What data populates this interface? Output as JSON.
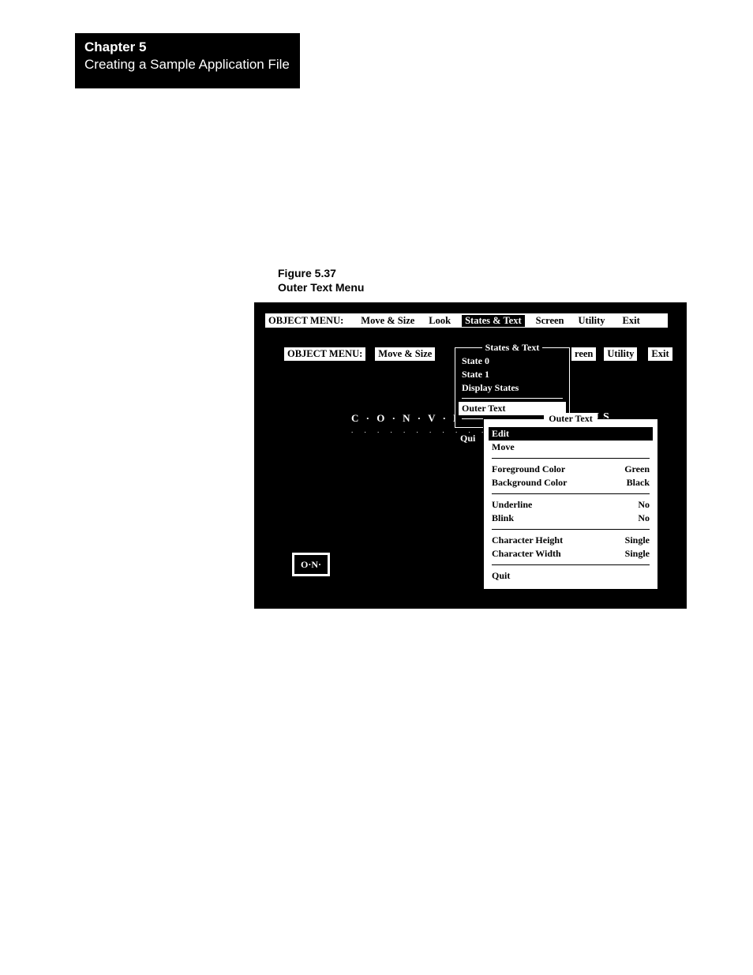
{
  "chapter": {
    "number": "Chapter 5",
    "title": "Creating a Sample Application File"
  },
  "figure": {
    "number": "Figure 5.37",
    "title": "Outer Text Menu"
  },
  "menubar_top": {
    "title": "OBJECT MENU:",
    "items": [
      "Move & Size",
      "Look",
      "States & Text",
      "Screen",
      "Utility",
      "Exit"
    ],
    "selected": "States & Text"
  },
  "menubar_inner": {
    "title": "OBJECT MENU:",
    "items": [
      "Move & Size",
      "reen",
      "Utility",
      "Exit"
    ]
  },
  "convey_label": "C · O · N · V · E · Y",
  "convey_dots": ". . . . . . . . . . . . . .",
  "on_box": "O·N·",
  "dropdown_states_text": {
    "legend": "States & Text",
    "items_top": [
      "State 0",
      "State 1",
      "Display States"
    ],
    "outer_text": "Outer Text",
    "quit": "Qui"
  },
  "peek_text": "P . O . I . S",
  "dropdown_outer_text": {
    "legend": "Outer Text",
    "edit": "Edit",
    "move": "Move",
    "rows1": [
      {
        "label": "Foreground Color",
        "value": "Green"
      },
      {
        "label": "Background Color",
        "value": "Black"
      }
    ],
    "rows2": [
      {
        "label": "Underline",
        "value": "No"
      },
      {
        "label": "Blink",
        "value": "No"
      }
    ],
    "rows3": [
      {
        "label": "Character Height",
        "value": "Single"
      },
      {
        "label": "Character Width",
        "value": "Single"
      }
    ],
    "quit": "Quit"
  }
}
